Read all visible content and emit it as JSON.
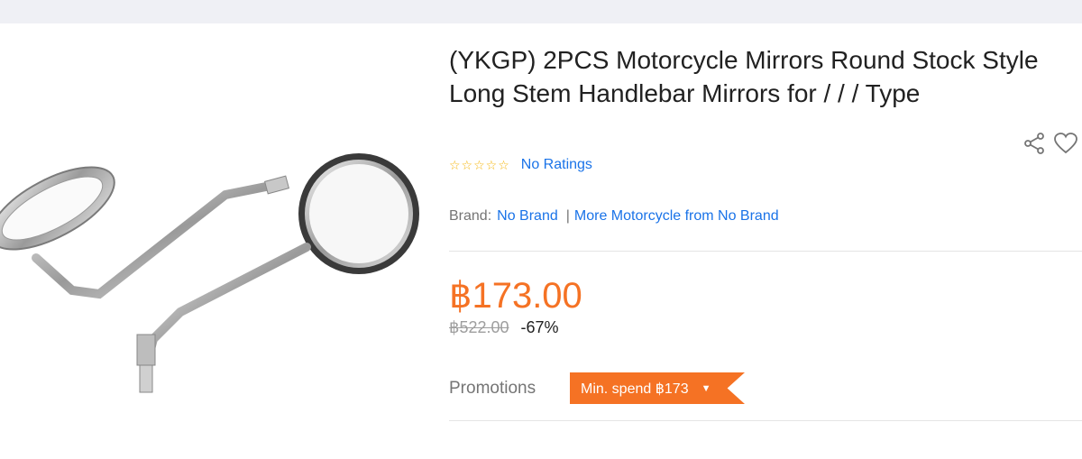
{
  "product": {
    "title": "(YKGP) 2PCS Motorcycle Mirrors Round Stock Style Long Stem Handlebar Mirrors for / / / Type",
    "stars": "☆☆☆☆☆",
    "ratings_text": "No Ratings",
    "brand_label": "Brand:",
    "brand_name": "No Brand",
    "brand_separator": "|",
    "more_link": "More Motorcycle from No Brand",
    "price": "฿173.00",
    "original_price": "฿522.00",
    "discount": "-67%",
    "promotions_label": "Promotions",
    "promo_tag": "Min. spend ฿173",
    "promo_caret": "▼"
  },
  "icons": {
    "share": "share-icon",
    "wishlist": "heart-icon"
  },
  "colors": {
    "price": "#f57224",
    "link": "#1a73e8",
    "star": "#f5b50a"
  }
}
